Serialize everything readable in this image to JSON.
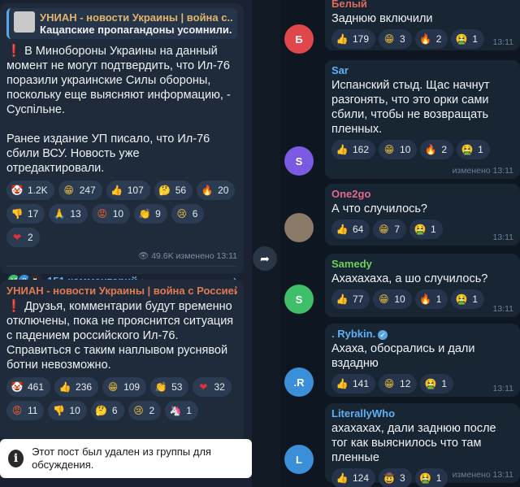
{
  "left": {
    "post1": {
      "reply_title": "УНИАН - новости Украины | война с...",
      "reply_sub": "Кацапские пропагандоны усомнили...",
      "excl": "❗",
      "p1": " В Минобороны Украины на данный момент не могут подтвердить, что Ил-76 поразили украинские Силы обороны, поскольку еще выясняют информацию, - Суспільне.",
      "p2": "Ранее издание УП писало, что Ил-76 сбили ВСУ. Новость уже отредактировали.",
      "reactions": [
        {
          "icon": "clown-face-icon",
          "glyph": "🤡",
          "color": "#f2f2f2",
          "count": "1.2K"
        },
        {
          "icon": "grinning-face-icon",
          "glyph": "😁",
          "color": "#f5c33b",
          "count": "247"
        },
        {
          "icon": "thumbs-up-icon",
          "glyph": "👍",
          "color": "#f5c33b",
          "count": "107"
        },
        {
          "icon": "thinking-face-icon",
          "glyph": "🤔",
          "color": "#f5c33b",
          "count": "56"
        },
        {
          "icon": "fire-icon",
          "glyph": "🔥",
          "color": "#ff7a1a",
          "count": "20"
        },
        {
          "icon": "thumbs-down-icon",
          "glyph": "👎",
          "color": "#f5c33b",
          "count": "17"
        },
        {
          "icon": "folded-hands-icon",
          "glyph": "🙏",
          "color": "#f5c33b",
          "count": "13"
        },
        {
          "icon": "angry-face-icon",
          "glyph": "😡",
          "color": "#ff5a2a",
          "count": "10"
        },
        {
          "icon": "clapping-hands-icon",
          "glyph": "👏",
          "color": "#f5c33b",
          "count": "9"
        },
        {
          "icon": "crying-face-icon",
          "glyph": "😢",
          "color": "#f5c33b",
          "count": "6"
        },
        {
          "icon": "heart-icon",
          "glyph": "❤",
          "color": "#e0303a",
          "count": "2"
        }
      ],
      "meta": "👁 49.6K  изменено 13:11",
      "comments": "151 комментарий •",
      "avatars": [
        "АЛ",
        "Р",
        "✖"
      ]
    },
    "post2": {
      "channel": "УНИАН - новости Украины | война с Россией...",
      "excl": "❗",
      "text": " Друзья, комментарии будут временно отключены, пока не прояснится ситуация с падением российского Ил-76. Справиться с таким наплывом руснявой ботни невозможно.",
      "reactions": [
        {
          "icon": "clown-face-icon",
          "glyph": "🤡",
          "color": "#f2f2f2",
          "count": "461"
        },
        {
          "icon": "thumbs-up-icon",
          "glyph": "👍",
          "color": "#f5c33b",
          "count": "236"
        },
        {
          "icon": "grinning-face-icon",
          "glyph": "😁",
          "color": "#f5c33b",
          "count": "109"
        },
        {
          "icon": "clapping-hands-icon",
          "glyph": "👏",
          "color": "#f5c33b",
          "count": "53"
        },
        {
          "icon": "heart-icon",
          "glyph": "❤",
          "color": "#e0303a",
          "count": "32"
        },
        {
          "icon": "angry-face-icon",
          "glyph": "😡",
          "color": "#ff5a2a",
          "count": "11"
        },
        {
          "icon": "thumbs-down-icon",
          "glyph": "👎",
          "color": "#f5c33b",
          "count": "10"
        },
        {
          "icon": "thinking-face-icon",
          "glyph": "🤔",
          "color": "#f5c33b",
          "count": "6"
        },
        {
          "icon": "crying-face-icon",
          "glyph": "😢",
          "color": "#f5c33b",
          "count": "2"
        },
        {
          "icon": "unicorn-icon",
          "glyph": "🦄",
          "color": "#e8b8ff",
          "count": "1"
        }
      ]
    },
    "toast": {
      "icon": "i",
      "text": "Этот пост был удален из группы для обсуждения."
    }
  },
  "right": {
    "messages": [
      {
        "name": "Белый",
        "name_color": "#e06a5a",
        "text": "Заднюю включили",
        "avatar": "Б",
        "avatar_color": "#e0474a",
        "reactions": [
          [
            "thumbs-up-icon",
            "👍",
            "#f5c33b",
            "179"
          ],
          [
            "grinning-face-icon",
            "😁",
            "#f5c33b",
            "3"
          ],
          [
            "fire-icon",
            "🔥",
            "#ff7a1a",
            "2"
          ],
          [
            "nauseated-face-icon",
            "🤮",
            "#6fcf5a",
            "1"
          ]
        ],
        "time": "13:11"
      },
      {
        "name": "Sar",
        "name_color": "#5fb0f5",
        "text": "Испанский стыд. Щас начнут разгонять, что это орки сами сбили, чтобы не возвращать пленных.",
        "avatar": "S",
        "avatar_color": "#7a5ae0",
        "reactions": [
          [
            "thumbs-up-icon",
            "👍",
            "#f5c33b",
            "162"
          ],
          [
            "grinning-face-icon",
            "😁",
            "#f5c33b",
            "10"
          ],
          [
            "fire-icon",
            "🔥",
            "#ff7a1a",
            "2"
          ],
          [
            "nauseated-face-icon",
            "🤮",
            "#6fcf5a",
            "1"
          ]
        ],
        "time": "изменено 13:11"
      },
      {
        "name": "One2go",
        "name_color": "#e06a8a",
        "text": "А что случилось?",
        "avatar": "",
        "avatar_color": "#8a7a6a",
        "reactions": [
          [
            "thumbs-up-icon",
            "👍",
            "#f5c33b",
            "64"
          ],
          [
            "grinning-face-icon",
            "😁",
            "#f5c33b",
            "7"
          ],
          [
            "nauseated-face-icon",
            "🤮",
            "#6fcf5a",
            "1"
          ]
        ],
        "time": "13:11"
      },
      {
        "name": "Samedy",
        "name_color": "#6fcf5a",
        "text": "Ахахахаха, а шо случилось?",
        "avatar": "S",
        "avatar_color": "#3fbf6a",
        "reactions": [
          [
            "thumbs-up-icon",
            "👍",
            "#f5c33b",
            "77"
          ],
          [
            "grinning-face-icon",
            "😁",
            "#f5c33b",
            "10"
          ],
          [
            "fire-icon",
            "🔥",
            "#ff7a1a",
            "1"
          ],
          [
            "nauseated-face-icon",
            "🤮",
            "#6fcf5a",
            "1"
          ]
        ],
        "time": "13:11"
      },
      {
        "name": ". Rybkin.",
        "name_color": "#5fb0f5",
        "text": "Ахаха, обосрались и дали вздадню",
        "avatar": ".R",
        "avatar_color": "#3a8fd8",
        "reactions": [
          [
            "thumbs-up-icon",
            "👍",
            "#f5c33b",
            "141"
          ],
          [
            "grinning-face-icon",
            "😁",
            "#f5c33b",
            "12"
          ],
          [
            "nauseated-face-icon",
            "🤮",
            "#6fcf5a",
            "1"
          ]
        ],
        "time": "13:11"
      },
      {
        "name": "LiterallyWho",
        "name_color": "#5fb0f5",
        "text": "ахахахах, дали заднюю после тог как выяснилось что там пленные",
        "avatar": "L",
        "avatar_color": "#3a8fd8",
        "reactions": [
          [
            "thumbs-up-icon",
            "👍",
            "#f5c33b",
            "124"
          ],
          [
            "cowboy-face-icon",
            "🤠",
            "#f5c33b",
            "3"
          ],
          [
            "nauseated-face-icon",
            "🤮",
            "#6fcf5a",
            "1"
          ]
        ],
        "time": "изменено 13:11"
      }
    ]
  }
}
